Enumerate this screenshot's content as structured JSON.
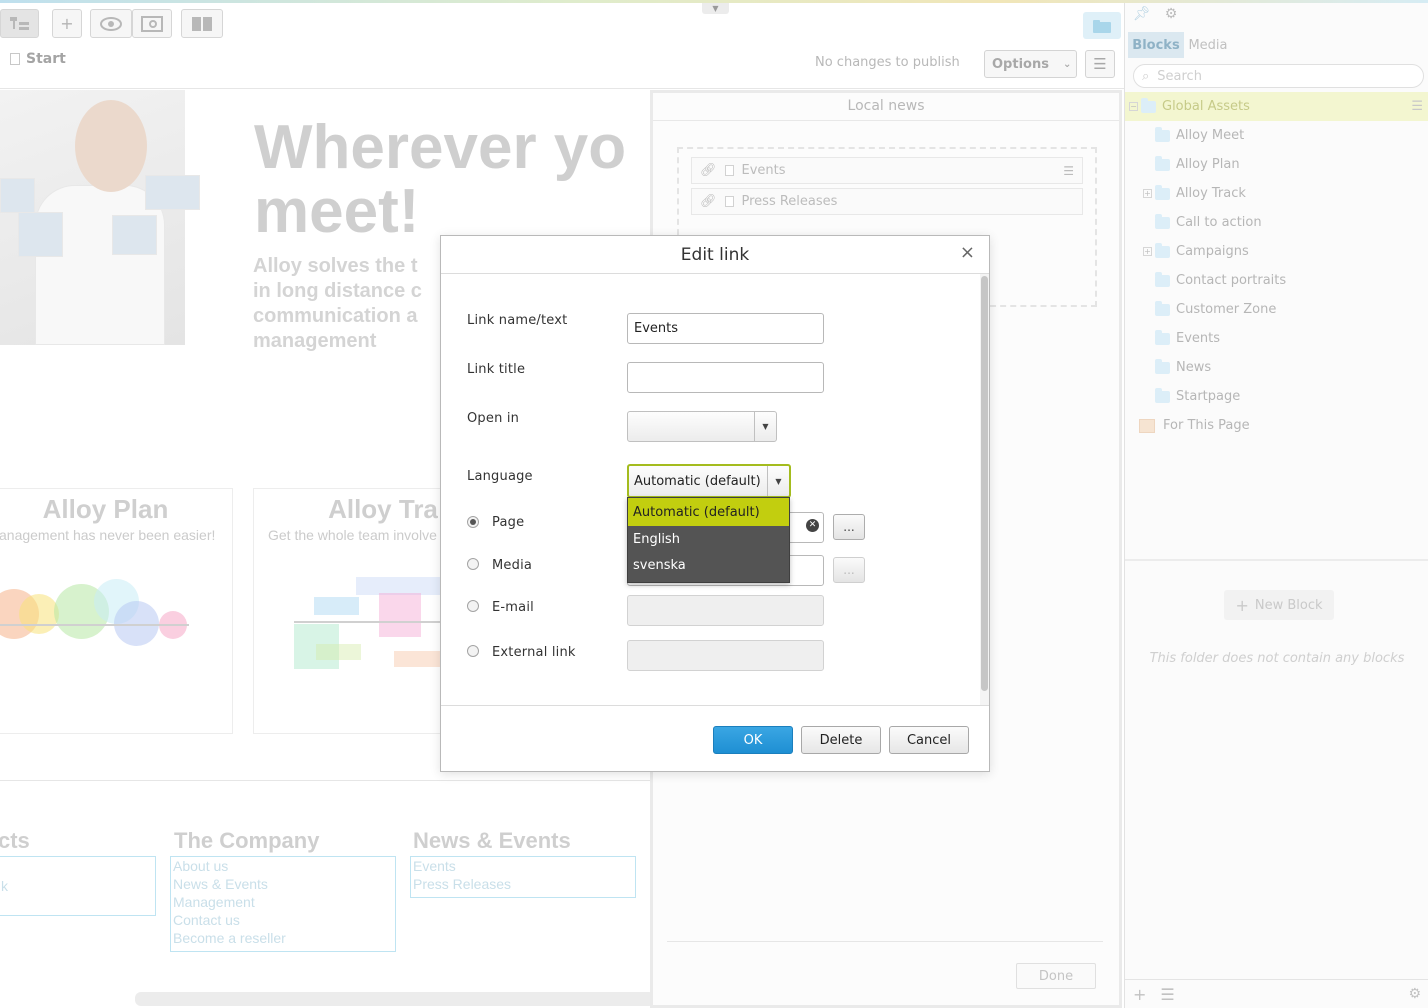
{
  "toolbar": {
    "breadcrumb": "Start",
    "publish_status": "No changes to publish",
    "options_label": "Options"
  },
  "preview": {
    "hero_title": "Wherever yo\nmeet!",
    "hero_text": "Alloy solves the t\nin long distance c\ncommunication a\nmanagement",
    "cards": [
      {
        "title": "Alloy Plan",
        "subtitle": "anagement has never been easier!"
      },
      {
        "title": "Alloy Tra",
        "subtitle": "Get the whole team involve"
      }
    ],
    "footer": {
      "col1_title": "cts",
      "col1_links": [
        "k"
      ],
      "col2_title": "The Company",
      "col2_links": [
        "About us",
        "News & Events",
        "Management",
        "Contact us",
        "Become a reseller"
      ],
      "col3_title": "News & Events",
      "col3_links": [
        "Events",
        "Press Releases"
      ]
    }
  },
  "local_panel": {
    "title": "Local news",
    "items": [
      "Events",
      "Press Releases"
    ],
    "done_label": "Done"
  },
  "sidebar": {
    "tabs": [
      "Blocks",
      "Media"
    ],
    "search_placeholder": "Search",
    "tree": [
      {
        "label": "Global Assets",
        "selected": true
      },
      {
        "label": "Alloy Meet"
      },
      {
        "label": "Alloy Plan"
      },
      {
        "label": "Alloy Track"
      },
      {
        "label": "Call to action"
      },
      {
        "label": "Campaigns"
      },
      {
        "label": "Contact portraits"
      },
      {
        "label": "Customer Zone"
      },
      {
        "label": "Events"
      },
      {
        "label": "News"
      },
      {
        "label": "Startpage"
      },
      {
        "label": "For This Page"
      }
    ],
    "new_block_label": "New Block",
    "empty_message": "This folder does not contain any blocks"
  },
  "dialog": {
    "title": "Edit link",
    "close_glyph": "×",
    "labels": {
      "link_name": "Link name/text",
      "link_title": "Link title",
      "open_in": "Open in",
      "language": "Language"
    },
    "link_name_value": "Events",
    "link_title_value": "",
    "open_in_value": "",
    "language_value": "Automatic (default)",
    "link_types": [
      "Page",
      "Media",
      "E-mail",
      "External link"
    ],
    "selected_type": "Page",
    "browse_label": "...",
    "buttons": {
      "ok": "OK",
      "delete": "Delete",
      "cancel": "Cancel"
    }
  },
  "language_dropdown": {
    "options": [
      "Automatic (default)",
      "English",
      "svenska"
    ],
    "selected": "Automatic (default)"
  },
  "colors": {
    "accent_green": "#c2ce0f",
    "primary_blue": "#2196d8",
    "dropdown_bg": "#545454"
  }
}
